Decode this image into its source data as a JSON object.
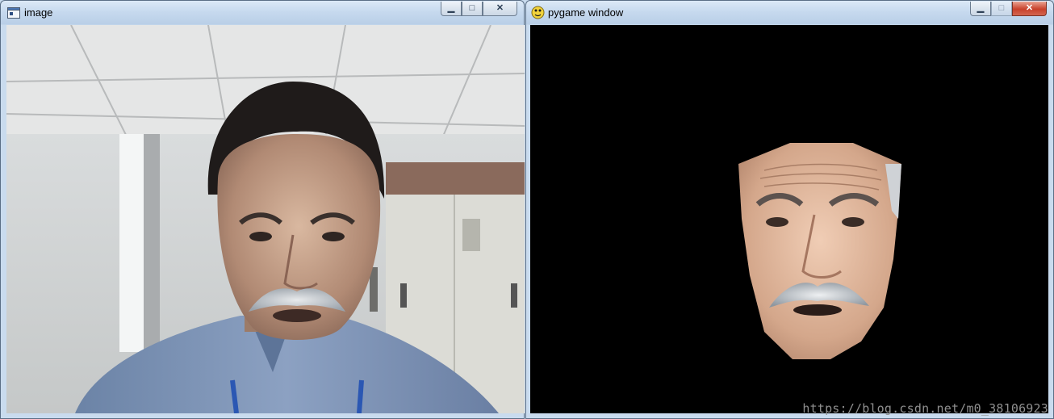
{
  "windows": [
    {
      "title": "image",
      "icon": "opencv-window-icon",
      "buttons": [
        "minimize",
        "maximize",
        "close"
      ]
    },
    {
      "title": "pygame window",
      "icon": "pygame-snake-icon",
      "buttons": [
        "minimize",
        "maximize",
        "close"
      ]
    }
  ],
  "watermark": "https://blog.csdn.net/m0_38106923",
  "colors": {
    "titlebar": "#c6d9ee",
    "close_red": "#c8412b",
    "client_black": "#000000"
  }
}
